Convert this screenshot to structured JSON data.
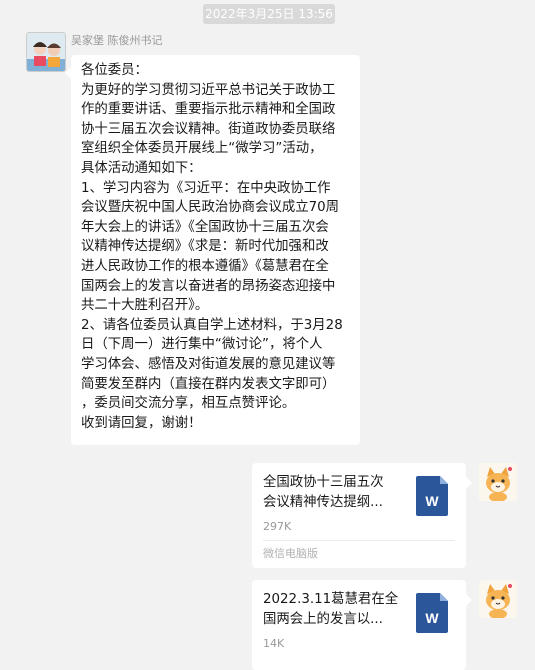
{
  "timestamp": "2022年3月25日 13:56",
  "incoming_message": {
    "sender": "吴家堡 陈俊州书记",
    "avatar_icon": "group-photo-avatar",
    "lines": [
      "各位委员：",
      "为更好的学习贯彻习近平总书记关于政协工",
      "作的重要讲话、重要指示批示精神和全国政",
      "协十三届五次会议精神。街道政协委员联络",
      "室组织全体委员开展线上“微学习”活动，",
      "具体活动通知如下：",
      "1、学习内容为《习近平：在中央政协工作",
      "会议暨庆祝中国人民政治协商会议成立70周",
      "年大会上的讲话》《全国政协十三届五次会",
      "议精神传达提纲》《求是：新时代加强和改",
      "进人民政协工作的根本遵循》《葛慧君在全",
      "国两会上的发言以奋进者的昂扬姿态迎接中",
      "共二十大胜利召开》。",
      "2、请各位委员认真自学上述材料，于3月28",
      "日（下周一）进行集中“微讨论”，将个人",
      "学习体会、感悟及对街道发展的意见建议等",
      "简要发至群内（直接在群内发表文字即可）",
      "，委员间交流分享，相互点赞评论。",
      "收到请回复，谢谢！"
    ]
  },
  "files": [
    {
      "name_lines": [
        "全国政协十三届五次",
        "会议精神传达提纲..."
      ],
      "size": "297K",
      "source": "微信电脑版",
      "icon": "word-doc-icon",
      "icon_letter": "W"
    },
    {
      "name_lines": [
        "2022.3.11葛慧君在全",
        "国两会上的发言以..."
      ],
      "size": "14K",
      "source": "",
      "icon": "word-doc-icon",
      "icon_letter": "W"
    }
  ],
  "self_avatar_icon": "cartoon-cat-avatar",
  "colors": {
    "background": "#f2f2f2",
    "bubble": "#ffffff",
    "word_blue": "#2b579a",
    "timestamp_bg": "#d9d9d9"
  }
}
